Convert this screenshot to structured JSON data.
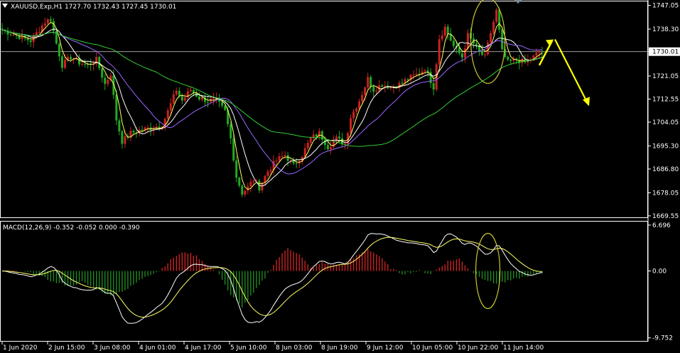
{
  "chart_data": [
    {
      "type": "candlestick",
      "title": "XAUUSD.Exp,H1  1727.70 1732.43 1727.45 1730.01",
      "symbol_icon": "triangle-down-icon",
      "ylim": [
        1669.0,
        1748.5
      ],
      "y_ticks": [
        "1747.05",
        "1738.30",
        "1730.01",
        "1721.05",
        "1712.55",
        "1704.05",
        "1695.30",
        "1686.80",
        "1678.05",
        "1669.55"
      ],
      "current_price": "1730.01",
      "x_ticks": [
        "1 Jun 2020",
        "2 Jun 15:00",
        "3 Jun 08:00",
        "4 Jun 01:00",
        "4 Jun 17:00",
        "5 Jun 10:00",
        "8 Jun 03:00",
        "8 Jun 19:00",
        "9 Jun 12:00",
        "10 Jun 05:00",
        "10 Jun 22:00",
        "11 Jun 14:00"
      ],
      "close_anchors": [
        [
          0,
          1738
        ],
        [
          5,
          1736
        ],
        [
          10,
          1734
        ],
        [
          15,
          1741
        ],
        [
          17,
          1742
        ],
        [
          19,
          1733
        ],
        [
          21,
          1725
        ],
        [
          24,
          1728
        ],
        [
          27,
          1726
        ],
        [
          30,
          1725
        ],
        [
          33,
          1727
        ],
        [
          36,
          1718
        ],
        [
          38,
          1722
        ],
        [
          40,
          1705
        ],
        [
          42,
          1697
        ],
        [
          45,
          1700
        ],
        [
          48,
          1701
        ],
        [
          52,
          1702
        ],
        [
          56,
          1703
        ],
        [
          58,
          1708
        ],
        [
          61,
          1716
        ],
        [
          63,
          1712
        ],
        [
          66,
          1716
        ],
        [
          69,
          1713
        ],
        [
          72,
          1712
        ],
        [
          75,
          1712
        ],
        [
          78,
          1708
        ],
        [
          80,
          1698
        ],
        [
          82,
          1684
        ],
        [
          84,
          1678
        ],
        [
          86,
          1680
        ],
        [
          88,
          1683
        ],
        [
          90,
          1680
        ],
        [
          93,
          1686
        ],
        [
          96,
          1690
        ],
        [
          99,
          1692
        ],
        [
          102,
          1688
        ],
        [
          105,
          1692
        ],
        [
          108,
          1698
        ],
        [
          111,
          1700
        ],
        [
          114,
          1695
        ],
        [
          117,
          1698
        ],
        [
          120,
          1696
        ],
        [
          122,
          1706
        ],
        [
          125,
          1712
        ],
        [
          128,
          1720
        ],
        [
          130,
          1716
        ],
        [
          133,
          1718
        ],
        [
          136,
          1717
        ],
        [
          139,
          1718
        ],
        [
          142,
          1720
        ],
        [
          146,
          1722
        ],
        [
          148,
          1724
        ],
        [
          151,
          1717
        ],
        [
          153,
          1735
        ],
        [
          155,
          1739
        ],
        [
          158,
          1732
        ],
        [
          161,
          1728
        ],
        [
          163,
          1736
        ],
        [
          165,
          1733
        ],
        [
          167,
          1730
        ],
        [
          169,
          1728
        ],
        [
          171,
          1737
        ],
        [
          173,
          1745
        ],
        [
          175,
          1730
        ],
        [
          177,
          1726
        ],
        [
          180,
          1727
        ],
        [
          183,
          1726
        ],
        [
          186,
          1728
        ],
        [
          188,
          1730
        ]
      ],
      "overlays": [
        {
          "name": "",
          "color": "#ffff66",
          "period": 4
        },
        {
          "name": "",
          "color": "#ffffff",
          "period": 9
        },
        {
          "name": "",
          "color": "#9966ff",
          "period": 20
        },
        {
          "name": "",
          "color": "#33cc33",
          "period": 55
        }
      ],
      "annotations": {
        "circle_color": "#c8c832",
        "arrow_color": "#ffff00",
        "arrow_up": {
          "from": 1725,
          "to": 1734
        },
        "arrow_down": {
          "to": 1711
        }
      },
      "colors": {
        "up": "#cc2222",
        "down": "#22aa22",
        "grid": "#b4b4b4"
      }
    },
    {
      "type": "macd",
      "title": "MACD(12,26,9) -0.352 -0.052 0.000 -0.390",
      "ylim": [
        -10.2,
        7.2
      ],
      "y_ticks": [
        "6.696",
        "0.00",
        "-9.752"
      ],
      "histogram_anchors": [
        [
          0,
          0.0
        ],
        [
          6,
          0.0
        ],
        [
          12,
          -0.5
        ],
        [
          18,
          -1.6
        ],
        [
          24,
          -2.2
        ],
        [
          28,
          -1.6
        ],
        [
          33,
          -2.6
        ],
        [
          38,
          -3.6
        ],
        [
          44,
          -2.6
        ],
        [
          50,
          -0.8
        ],
        [
          55,
          0.0
        ],
        [
          60,
          2.0
        ],
        [
          64,
          2.8
        ],
        [
          68,
          2.2
        ],
        [
          72,
          0.8
        ],
        [
          76,
          -0.4
        ],
        [
          80,
          -3.6
        ],
        [
          84,
          -5.2
        ],
        [
          88,
          -3.2
        ],
        [
          92,
          -1.0
        ],
        [
          96,
          1.6
        ],
        [
          100,
          3.4
        ],
        [
          104,
          2.4
        ],
        [
          108,
          0.4
        ],
        [
          112,
          1.2
        ],
        [
          116,
          0.8
        ],
        [
          120,
          1.0
        ],
        [
          124,
          2.2
        ],
        [
          128,
          3.2
        ],
        [
          132,
          2.2
        ],
        [
          136,
          0.4
        ],
        [
          140,
          -0.4
        ],
        [
          146,
          0.0
        ],
        [
          150,
          -0.4
        ],
        [
          156,
          1.4
        ],
        [
          160,
          1.8
        ],
        [
          164,
          0.0
        ],
        [
          168,
          -1.0
        ],
        [
          172,
          -1.8
        ],
        [
          176,
          -1.6
        ],
        [
          182,
          -0.9
        ],
        [
          188,
          -0.3
        ]
      ],
      "line_color": "#ffffff",
      "signal_color": "#ffff66",
      "hist_up": "#cc2222",
      "hist_down": "#228822"
    }
  ]
}
